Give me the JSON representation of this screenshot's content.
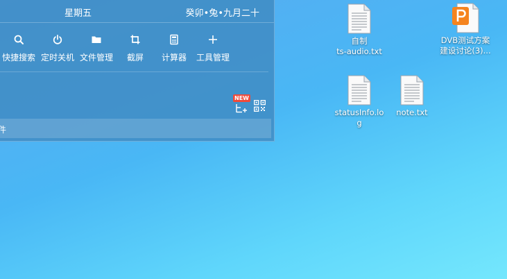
{
  "widget": {
    "weekday": "星期五",
    "lunar_date": "癸卯•兔•九月二十",
    "tools": [
      {
        "label": "快捷搜索",
        "icon": "search-icon"
      },
      {
        "label": "定时关机",
        "icon": "power-icon"
      },
      {
        "label": "文件管理",
        "icon": "folder-icon"
      },
      {
        "label": "截屏",
        "icon": "crop-icon"
      },
      {
        "label": "计算器",
        "icon": "calculator-icon"
      },
      {
        "label": "工具管理",
        "icon": "plus-icon"
      }
    ],
    "new_badge": "NEW",
    "bottom_text": "件"
  },
  "desktop": {
    "icons": [
      {
        "line1": "自制",
        "line2": "ts-audio.txt",
        "type": "text-file-icon"
      },
      {
        "line1": "DVB测试方案",
        "line2": "建设讨论(3)...",
        "type": "ppt-file-icon"
      },
      {
        "line1": "statusInfo.lo",
        "line2": "g",
        "type": "text-file-icon"
      },
      {
        "line1": "note.txt",
        "line2": "",
        "type": "text-file-icon"
      }
    ]
  },
  "colors": {
    "widget_bg": "#408cc4",
    "ppt_orange": "#f5841f",
    "badge_red": "#f04a3a"
  }
}
